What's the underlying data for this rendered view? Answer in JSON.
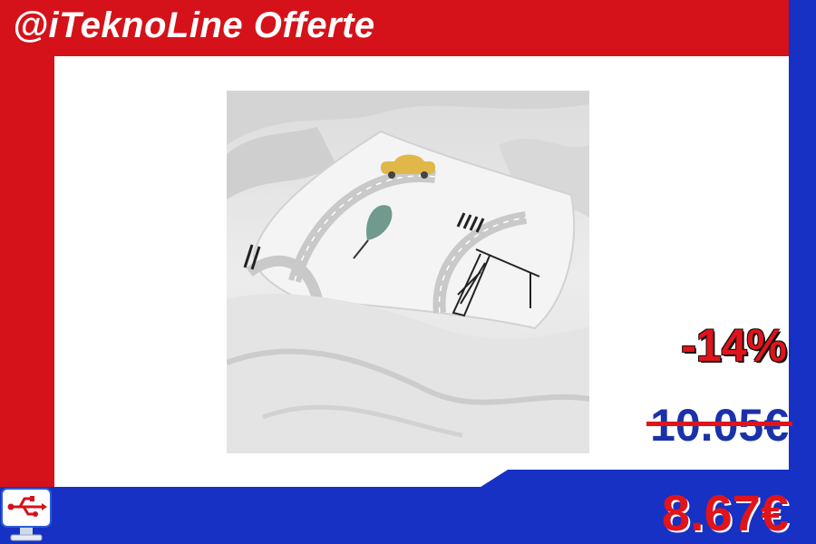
{
  "brand": {
    "title": "@iTeknoLine Offerte"
  },
  "product": {
    "image_description_icon": "pillow-photo"
  },
  "pricing": {
    "discount": "-14%",
    "old_price": "10.05€",
    "new_price": "8.67€"
  },
  "colors": {
    "brand_red": "#d51219",
    "brand_blue": "#1631c4",
    "price_red": "#e0141a",
    "old_price_blue": "#1a32a8"
  },
  "logo": {
    "icon": "usb-monitor-icon"
  }
}
